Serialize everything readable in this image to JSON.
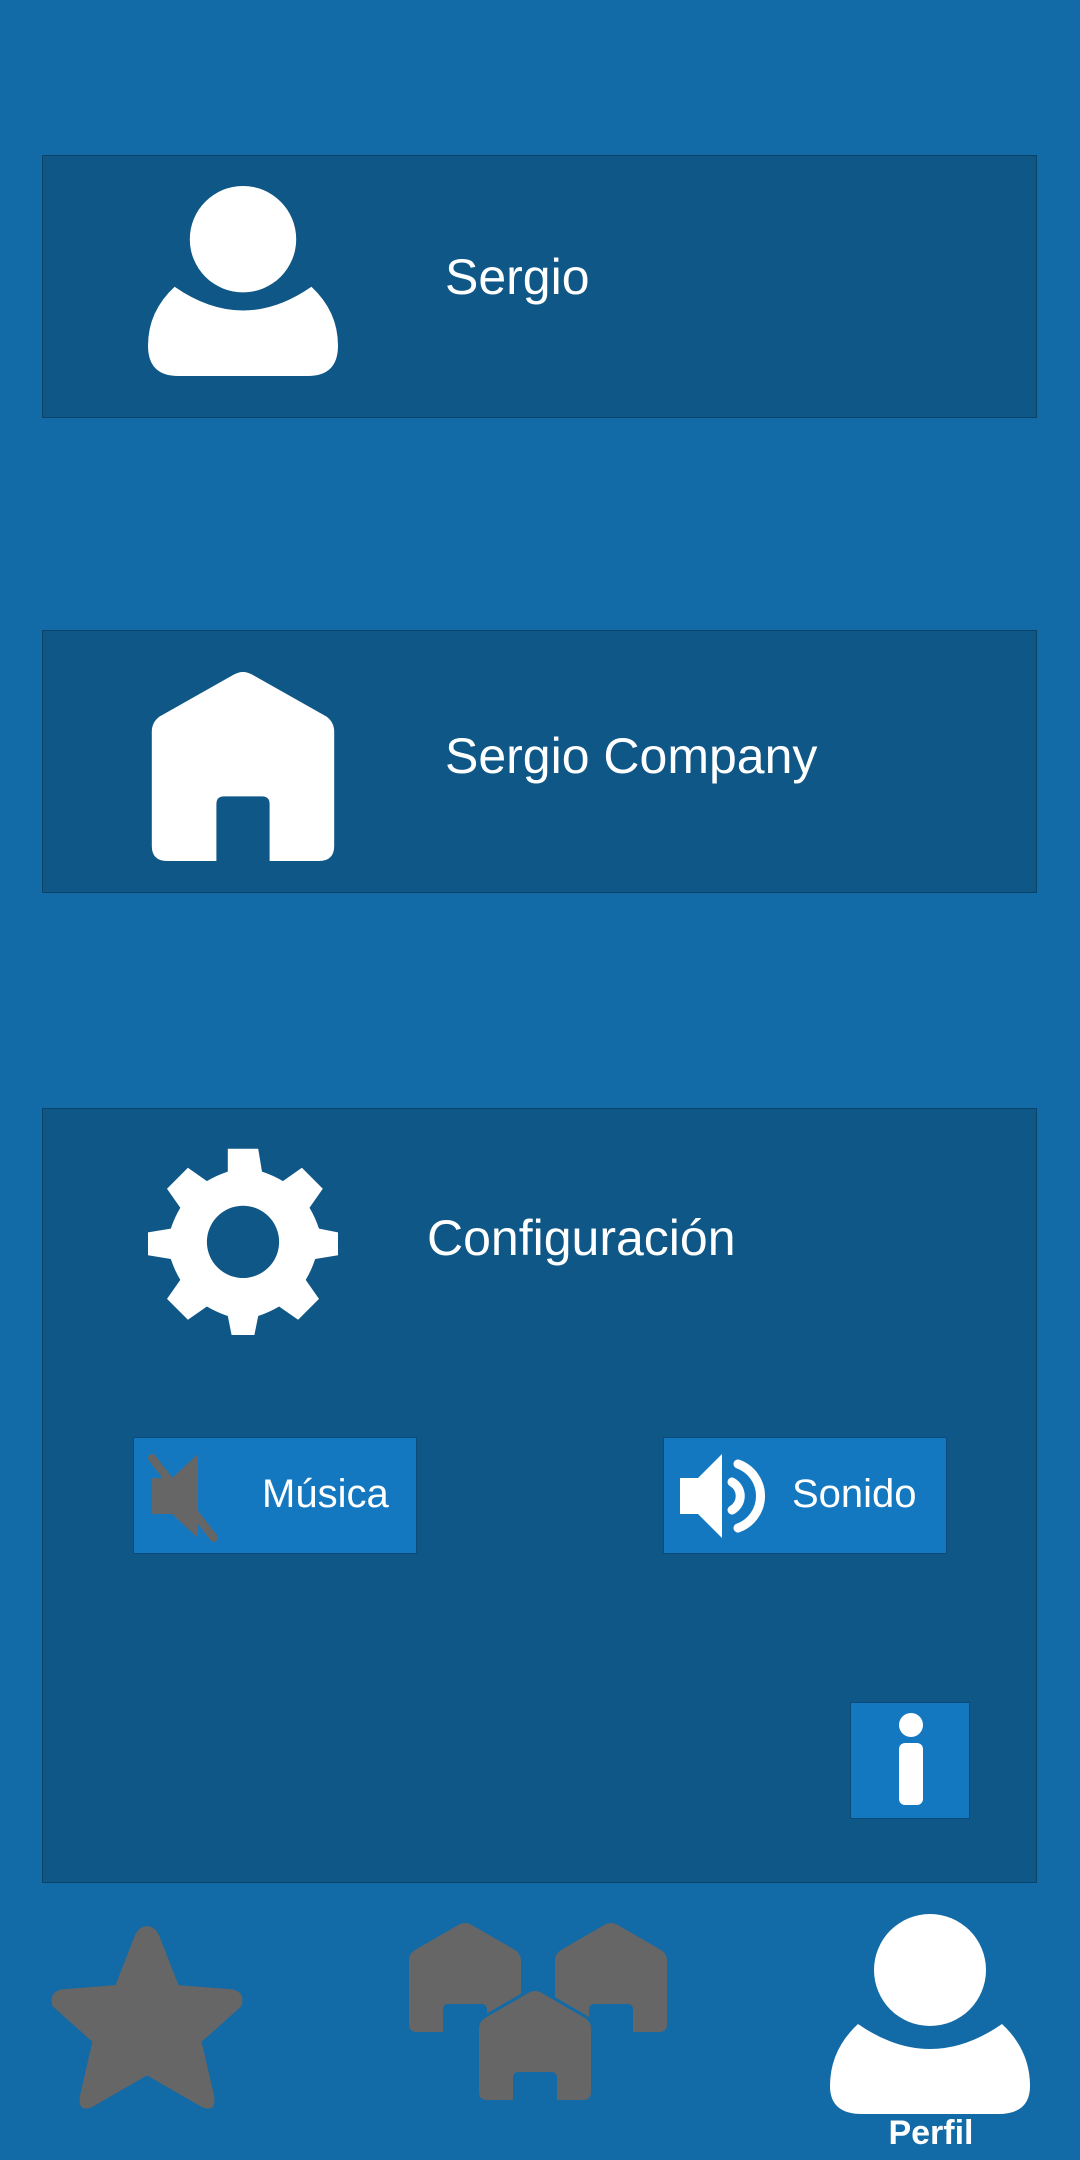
{
  "profile": {
    "user_name": "Sergio",
    "company_name": "Sergio Company"
  },
  "settings": {
    "title": "Configuración",
    "music_label": "Música",
    "music_state": "muted",
    "sound_label": "Sonido",
    "sound_state": "on"
  },
  "bottom_nav": {
    "items": [
      {
        "id": "favorites",
        "icon": "star-icon",
        "label": ""
      },
      {
        "id": "companies",
        "icon": "houses-icon",
        "label": ""
      },
      {
        "id": "profile",
        "icon": "user-icon",
        "label": "Perfil",
        "active": true
      }
    ]
  },
  "colors": {
    "background": "#126aa6",
    "card": "#0f5786",
    "button": "#1478c0",
    "icon_active": "#ffffff",
    "icon_inactive": "#666666"
  }
}
